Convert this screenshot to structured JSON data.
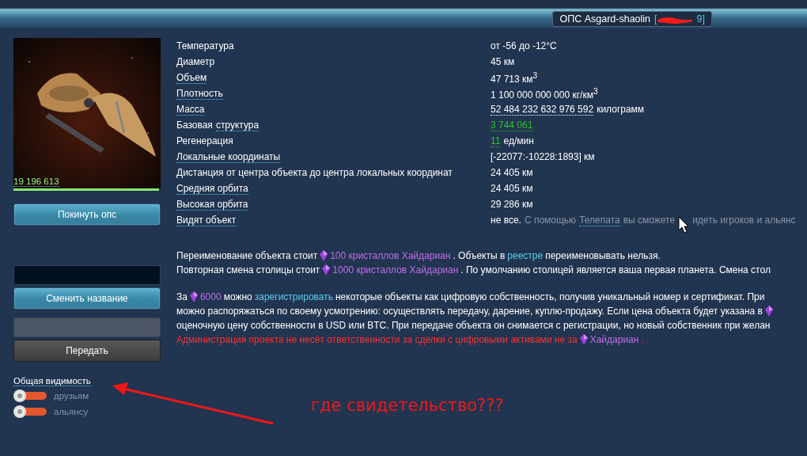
{
  "header": {
    "title": "ОПС Asgard-shaolin",
    "id_open": "[",
    "id_close": "9]",
    "redacted": true
  },
  "object": {
    "hp": "19 196 613",
    "level": 0.99
  },
  "buttons": {
    "leave": "Покинуть опс",
    "rename": "Сменить название",
    "transfer": "Передать"
  },
  "rename_field": {
    "disabled": false
  },
  "transfer_field": {
    "disabled": true
  },
  "visibility": {
    "title": "Общая видимость",
    "toggles": [
      {
        "label": "друзьям",
        "on": false
      },
      {
        "label": "альянсу",
        "on": false
      }
    ]
  },
  "properties": [
    {
      "label": "Температура",
      "hint": false,
      "value": [
        {
          "kind": "plain",
          "text": "от -56 до -12°C"
        }
      ]
    },
    {
      "label": "Диаметр",
      "hint": false,
      "value": [
        {
          "kind": "plain",
          "text": "45 км"
        }
      ]
    },
    {
      "label": "Объем",
      "hint": true,
      "value": [
        {
          "kind": "plain",
          "text": "47 713 км$^{3}$"
        }
      ]
    },
    {
      "label": "Плотность",
      "hint": true,
      "value": [
        {
          "kind": "plain",
          "text": "1 100 000 000 000 кг/км$^{3}$"
        }
      ]
    },
    {
      "label": "Масса",
      "hint": true,
      "value": [
        {
          "kind": "dotted",
          "text": "52 484 232 632 976 592"
        },
        {
          "kind": "plain",
          "text": "килограмм"
        }
      ]
    },
    {
      "label_plain": "Базовая",
      "label": "структура",
      "hint": true,
      "value": [
        {
          "kind": "green",
          "text": "3 744 061"
        }
      ]
    },
    {
      "label": "Регенерация",
      "hint": false,
      "value": [
        {
          "kind": "green",
          "text": "11"
        },
        {
          "kind": "plain",
          "text": "ед/мин"
        }
      ]
    },
    {
      "label": "Локальные координаты",
      "hint": true,
      "value": [
        {
          "kind": "plain",
          "text": "[-22077:-10228:1893] км"
        }
      ]
    },
    {
      "label": "Дистанция от центра объекта до центра локальных координат",
      "hint": false,
      "value": [
        {
          "kind": "plain",
          "text": "24 405 км"
        }
      ]
    },
    {
      "label": "Средняя орбита",
      "hint": true,
      "value": [
        {
          "kind": "plain",
          "text": "24 405 км"
        }
      ]
    },
    {
      "label": "Высокая орбита",
      "hint": true,
      "value": [
        {
          "kind": "plain",
          "text": "29 286 км"
        }
      ]
    },
    {
      "label": "Видят объект",
      "hint": true,
      "value": [
        {
          "kind": "plain",
          "text": "не все."
        },
        {
          "kind": "muted",
          "text": "С помощью"
        },
        {
          "kind": "link",
          "text": "Телепата"
        },
        {
          "kind": "muted",
          "text": "вы сможете"
        },
        {
          "kind": "muted",
          "text": "идеть игроков и альянс"
        }
      ]
    }
  ],
  "paragraphs": [
    [
      [
        {
          "kind": "plain",
          "text": "Переименование объекта стоит"
        },
        {
          "kind": "gem"
        },
        {
          "kind": "price",
          "text": "100 кристаллов Хайдариан"
        },
        {
          "kind": "plain",
          "text": ". Объекты в"
        },
        {
          "kind": "link",
          "text": "реестре"
        },
        {
          "kind": "plain",
          "text": "переименовывать нельзя."
        }
      ],
      [
        {
          "kind": "plain",
          "text": "Повторная смена столицы стоит"
        },
        {
          "kind": "gem"
        },
        {
          "kind": "price",
          "text": "1000 кристаллов Хайдариан"
        },
        {
          "kind": "plain",
          "text": ". По умолчанию столицей является ваша первая планета. Смена стол"
        }
      ]
    ],
    [
      [
        {
          "kind": "plain",
          "text": "За"
        },
        {
          "kind": "gem"
        },
        {
          "kind": "price",
          "text": "6000"
        },
        {
          "kind": "plain",
          "text": "можно"
        },
        {
          "kind": "link",
          "text": "зарегистрировать"
        },
        {
          "kind": "plain",
          "text": "некоторые объекты как цифровую собственность, получив уникальный номер и сертификат. При"
        }
      ],
      [
        {
          "kind": "plain",
          "text": "можно распоряжаться по своему усмотрению: осуществлять передачу, дарение, куплю-продажу. Если цена объекта будет указана в"
        },
        {
          "kind": "gem"
        }
      ],
      [
        {
          "kind": "plain",
          "text": "оценочную цену собственности в USD или BTC. При передаче объекта он снимается с регистрации, но новый собственник при желан"
        }
      ],
      [
        {
          "kind": "warn",
          "text": "Администрация проекта не несёт ответственности за сделки с цифровыми активами не за"
        },
        {
          "kind": "gem"
        },
        {
          "kind": "price",
          "text": "Хайдариан"
        },
        {
          "kind": "warn",
          "text": "."
        }
      ]
    ]
  ],
  "annotation": {
    "text": "где свидетельство???"
  }
}
